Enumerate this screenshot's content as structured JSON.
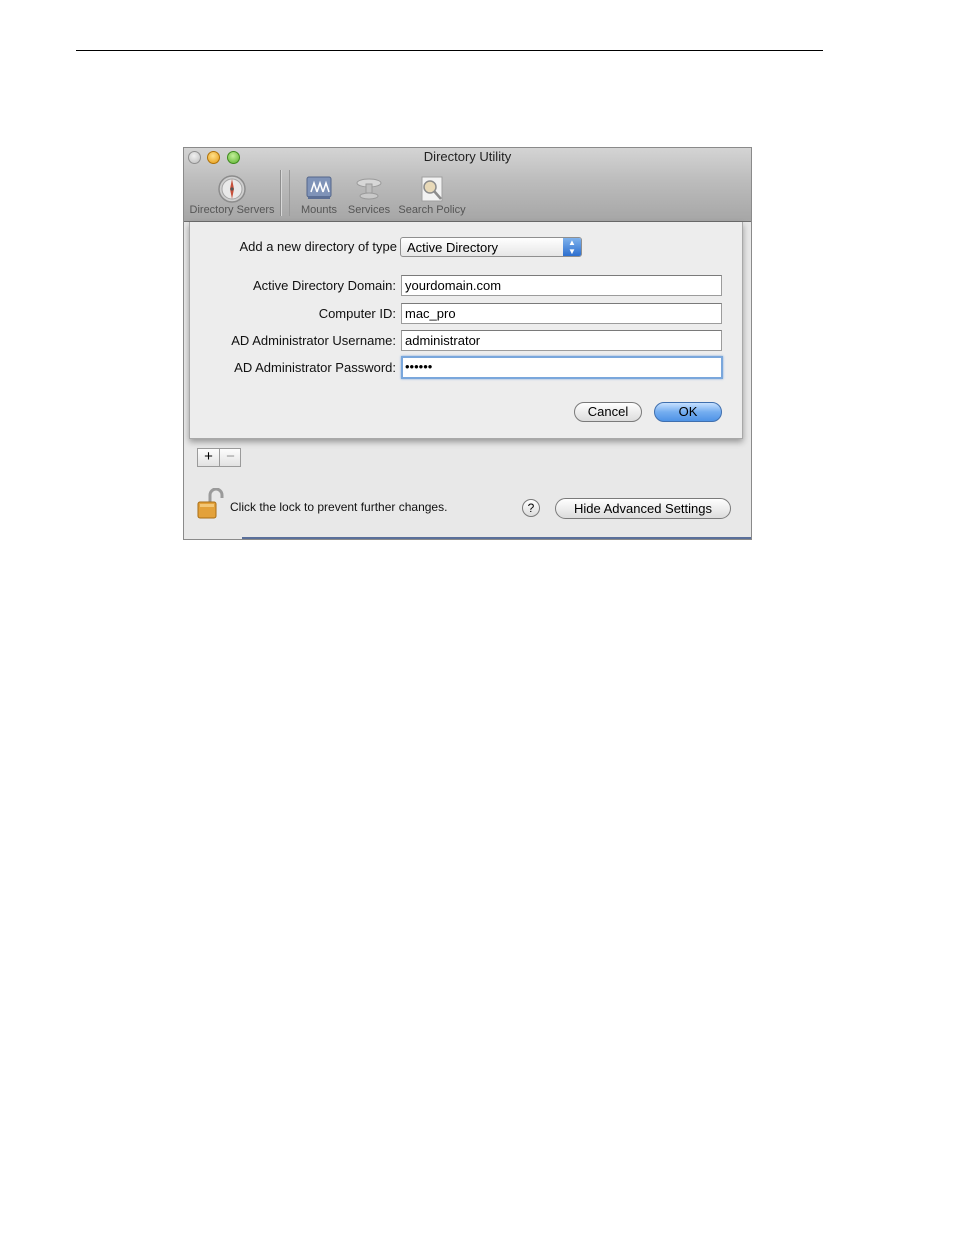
{
  "window": {
    "title": "Directory Utility"
  },
  "toolbar": {
    "items": [
      {
        "label": "Directory Servers",
        "icon": "compass-icon"
      },
      {
        "label": "Mounts",
        "icon": "mounts-icon"
      },
      {
        "label": "Services",
        "icon": "services-icon"
      },
      {
        "label": "Search Policy",
        "icon": "search-policy-icon"
      }
    ]
  },
  "sheet": {
    "type_label": "Add a new directory of type",
    "type_value": "Active Directory",
    "fields": [
      {
        "label": "Active Directory Domain:",
        "value": "yourdomain.com"
      },
      {
        "label": "Computer ID:",
        "value": "mac_pro"
      },
      {
        "label": "AD Administrator Username:",
        "value": "administrator"
      },
      {
        "label": "AD Administrator Password:",
        "value": "••••••"
      }
    ],
    "cancel_label": "Cancel",
    "ok_label": "OK"
  },
  "footer": {
    "add_label": "+",
    "remove_label": "−",
    "lock_text": "Click the lock to prevent further changes.",
    "help_label": "?",
    "advanced_label": "Hide Advanced Settings"
  },
  "colors": {
    "focus_ring": "#7aa7dc",
    "default_button": "#4f93e6"
  }
}
